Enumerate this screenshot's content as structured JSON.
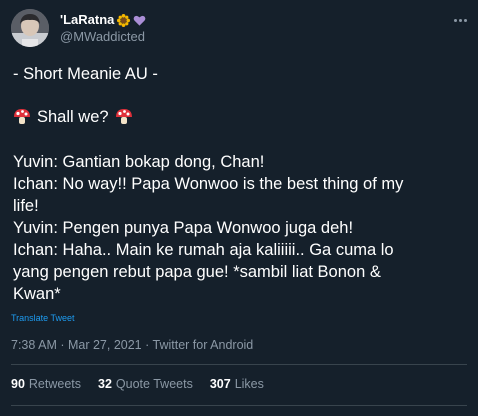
{
  "author": {
    "display_name": "'LaRatna",
    "handle": "@MWaddicted",
    "name_emojis": [
      "sunflower-icon",
      "purple-heart-icon"
    ]
  },
  "tweet": {
    "title_line": "- Short Meanie AU -",
    "shall_we": "Shall we?",
    "lines": [
      "Yuvin: Gantian bokap dong, Chan!",
      "Ichan: No way!! Papa Wonwoo is the best thing of my",
      "life!",
      "Yuvin: Pengen punya Papa Wonwoo juga deh!",
      "Ichan: Haha.. Main ke rumah aja kaliiiii.. Ga cuma lo",
      "yang pengen rebut papa gue! *sambil liat Bonon &",
      "Kwan*"
    ],
    "translate_label": "Translate Tweet",
    "meta": "7:38 AM · Mar 27, 2021 · Twitter for Android"
  },
  "stats": {
    "retweets_count": "90",
    "retweets_label": "Retweets",
    "quotes_count": "32",
    "quotes_label": "Quote Tweets",
    "likes_count": "307",
    "likes_label": "Likes"
  },
  "colors": {
    "background": "#15202b",
    "text": "#ffffff",
    "secondary": "#8b98a5",
    "link": "#1d9bf0",
    "divider": "#38444d"
  }
}
